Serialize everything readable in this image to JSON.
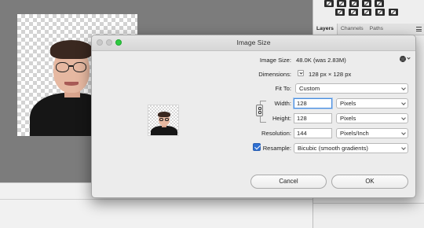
{
  "right_panel": {
    "tabs": [
      {
        "label": "Layers"
      },
      {
        "label": "Channels"
      },
      {
        "label": "Paths"
      }
    ]
  },
  "dialog": {
    "title": "Image Size",
    "image_size_label": "Image Size:",
    "image_size_value": "48.0K (was 2.83M)",
    "dimensions_label": "Dimensions:",
    "dimensions_value": "128 px  ×  128 px",
    "fit_to_label": "Fit To:",
    "fit_to_value": "Custom",
    "width_label": "Width:",
    "width_value": "128",
    "width_unit": "Pixels",
    "height_label": "Height:",
    "height_value": "128",
    "height_unit": "Pixels",
    "resolution_label": "Resolution:",
    "resolution_value": "144",
    "resolution_unit": "Pixels/Inch",
    "resample_label": "Resample:",
    "resample_checked": true,
    "resample_method": "Bicubic (smooth gradients)",
    "cancel_label": "Cancel",
    "ok_label": "OK"
  },
  "colors": {
    "accent": "#2f6fd1",
    "zoom_light": "#2ecb40",
    "focus_ring": "#4a8ddc"
  }
}
